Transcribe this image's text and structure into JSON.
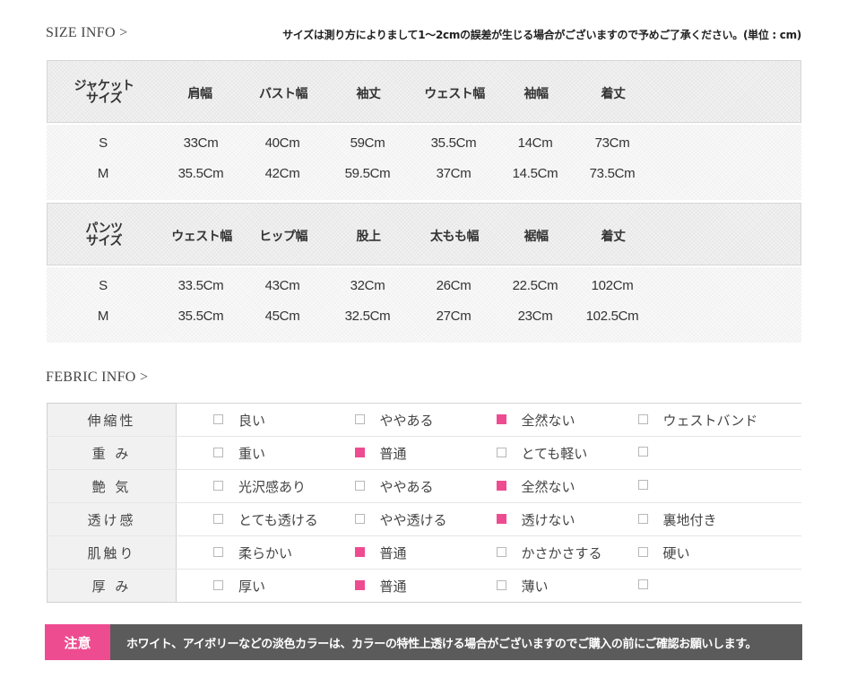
{
  "size_info": {
    "title": "SIZE INFO >",
    "note": "サイズは測り方によりまして1〜2cmの誤差が生じる場合がございますので予めご了承ください。(単位 : cm)"
  },
  "jacket": {
    "header_title_line1": "ジャケット",
    "header_title_line2": "サイズ",
    "columns": [
      "肩幅",
      "バスト幅",
      "袖丈",
      "ウェスト幅",
      "袖幅",
      "着丈"
    ],
    "rows": [
      {
        "size": "S",
        "values": [
          "33Cm",
          "40Cm",
          "59Cm",
          "35.5Cm",
          "14Cm",
          "73Cm"
        ]
      },
      {
        "size": "M",
        "values": [
          "35.5Cm",
          "42Cm",
          "59.5Cm",
          "37Cm",
          "14.5Cm",
          "73.5Cm"
        ]
      }
    ]
  },
  "pants": {
    "header_title_line1": "パンツ",
    "header_title_line2": "サイズ",
    "columns": [
      "ウェスト幅",
      "ヒップ幅",
      "股上",
      "太もも幅",
      "裾幅",
      "着丈"
    ],
    "rows": [
      {
        "size": "S",
        "values": [
          "33.5Cm",
          "43Cm",
          "32Cm",
          "26Cm",
          "22.5Cm",
          "102Cm"
        ]
      },
      {
        "size": "M",
        "values": [
          "35.5Cm",
          "45Cm",
          "32.5Cm",
          "27Cm",
          "23Cm",
          "102.5Cm"
        ]
      }
    ]
  },
  "fabric_info": {
    "title": "FEBRIC INFO >",
    "rows": [
      {
        "label": "伸縮性",
        "options": [
          {
            "text": "良い",
            "checked": false
          },
          {
            "text": "ややある",
            "checked": false
          },
          {
            "text": "全然ない",
            "checked": true
          },
          {
            "text": "ウェストバンド",
            "checked": false
          }
        ]
      },
      {
        "label": "重 み",
        "options": [
          {
            "text": "重い",
            "checked": false
          },
          {
            "text": "普通",
            "checked": true
          },
          {
            "text": "とても軽い",
            "checked": false
          },
          {
            "text": "",
            "checked": false
          }
        ]
      },
      {
        "label": "艶 気",
        "options": [
          {
            "text": "光沢感あり",
            "checked": false
          },
          {
            "text": "ややある",
            "checked": false
          },
          {
            "text": "全然ない",
            "checked": true
          },
          {
            "text": "",
            "checked": false
          }
        ]
      },
      {
        "label": "透け感",
        "options": [
          {
            "text": "とても透ける",
            "checked": false
          },
          {
            "text": "やや透ける",
            "checked": false
          },
          {
            "text": "透けない",
            "checked": true
          },
          {
            "text": "裏地付き",
            "checked": false
          }
        ]
      },
      {
        "label": "肌触り",
        "options": [
          {
            "text": "柔らかい",
            "checked": false
          },
          {
            "text": "普通",
            "checked": true
          },
          {
            "text": "かさかさする",
            "checked": false
          },
          {
            "text": "硬い",
            "checked": false
          }
        ]
      },
      {
        "label": "厚 み",
        "options": [
          {
            "text": "厚い",
            "checked": false
          },
          {
            "text": "普通",
            "checked": true
          },
          {
            "text": "薄い",
            "checked": false
          },
          {
            "text": "",
            "checked": false
          }
        ]
      }
    ]
  },
  "notice": {
    "label": "注意",
    "text": "ホワイト、アイボリーなどの淡色カラーは、カラーの特性上透ける場合がございますのでご購入の前にご確認お願いします。"
  },
  "colors": {
    "accent": "#ee4c91",
    "notice_bg": "#5b5b5b"
  }
}
